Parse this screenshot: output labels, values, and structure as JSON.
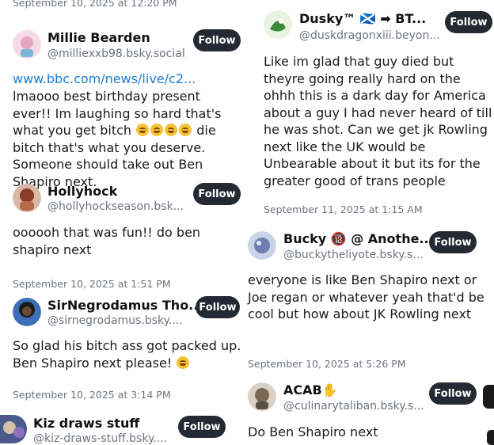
{
  "follow_label": "Follow",
  "left": {
    "top_timestamp": "September 10, 2025 at 12:20 PM",
    "post1": {
      "name": "Millie Bearden",
      "handle": "@milliexxb98.bsky.social",
      "link": "www.bbc.com/news/live/c2...",
      "text_before_emoji": "lmaooo best birthday present ever!! Im laughing so hard that's what you get bitch",
      "text_after_emoji": " die bitch that's what you deserve. Someone should take out Ben Shapiro next."
    },
    "post2": {
      "name": "Hollyhock",
      "handle": "@hollyhockseason.bsk...",
      "text": "oooooh that was fun!! do ben shapiro next"
    },
    "post3": {
      "timestamp": "September 10, 2025 at 1:51 PM",
      "name": "SirNegrodamus Tho...",
      "handle": "@sirnegrodamus.bsky....",
      "text": "So glad his bitch ass got packed up. Ben Shapiro next please!"
    },
    "post4": {
      "timestamp": "September 10, 2025 at 3:14 PM",
      "name": "Kiz draws stuff",
      "handle": "@kiz-draws-stuff.bsky...."
    }
  },
  "right": {
    "post1": {
      "name": "Dusky™ 🏴󠁧󠁢󠁳󠁣󠁴󠁿 ➡ BT...",
      "handle": "@duskdragonxiii.beyon...",
      "text": "Like im glad that guy died but theyre going really hard on the ohhh this is a dark day for America about a guy I had never heard of till he was shot. Can we get jk Rowling next like the UK would be Unbearable about it but its for the greater good of trans people",
      "timestamp": "September 11, 2025 at 1:15 AM"
    },
    "post2": {
      "name": "Bucky 🔞 @ Anothe...",
      "handle": "@buckytheliyote.bsky.s...",
      "text": "everyone is like Ben Shapiro next or Joe regan or whatever yeah that'd be cool but how about JK Rowling next",
      "timestamp": "September 10, 2025 at 5:26 PM"
    },
    "post3": {
      "name": "ACAB✋",
      "handle": "@culinarytaliban.bsky.s...",
      "text": "Do Ben Shapiro next"
    }
  }
}
